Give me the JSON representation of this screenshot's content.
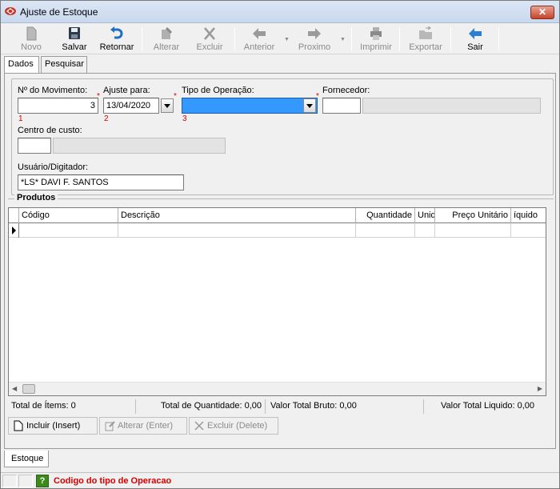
{
  "window": {
    "title": "Ajuste de Estoque",
    "close_label": "✕"
  },
  "toolbar": {
    "novo": "Novo",
    "salvar": "Salvar",
    "retornar": "Retornar",
    "alterar": "Alterar",
    "excluir": "Excluir",
    "anterior": "Anterior",
    "proximo": "Proximo",
    "imprimir": "Imprimir",
    "exportar": "Exportar",
    "sair": "Sair"
  },
  "tabs": {
    "dados": "Dados",
    "pesquisar": "Pesquisar"
  },
  "form": {
    "movimento_label": "Nº do Movimento:",
    "movimento_value": "3",
    "movimento_index": "1",
    "ajuste_label": "Ajuste para:",
    "ajuste_value": "13/04/2020",
    "ajuste_index": "2",
    "tipo_label": "Tipo de Operação:",
    "tipo_value": "",
    "tipo_index": "3",
    "fornecedor_label": "Fornecedor:",
    "fornecedor_code": "",
    "fornecedor_name": "",
    "centro_label": "Centro de custo:",
    "centro_code": "",
    "centro_name": "",
    "usuario_label": "Usuário/Digitador:",
    "usuario_value": "*LS* DAVI F. SANTOS",
    "required_mark": "*"
  },
  "produtos": {
    "title": "Produtos",
    "columns": [
      "Código",
      "Descrição",
      "Quantidade",
      "Unid",
      "Preço Unitário",
      "íquido"
    ],
    "rows": [
      [
        "",
        "",
        "",
        "",
        "",
        ""
      ]
    ]
  },
  "summary": {
    "total_itens": "Total de Ítems: 0",
    "total_quantidade": "Total de Quantidade: 0,00",
    "valor_bruto": "Valor Total Bruto: 0,00",
    "valor_liquido": "Valor Total Liquido: 0,00"
  },
  "actions": {
    "incluir": "Incluir (Insert)",
    "alterar": "Alterar (Enter)",
    "excluir": "Excluir (Delete)"
  },
  "bottom_tabs": {
    "estoque": "Estoque"
  },
  "status": {
    "help": "?",
    "message": "Codigo do tipo de Operacao"
  },
  "colors": {
    "selection": "#3399ff",
    "required": "#d40000",
    "status_help": "#3c8a1c"
  }
}
